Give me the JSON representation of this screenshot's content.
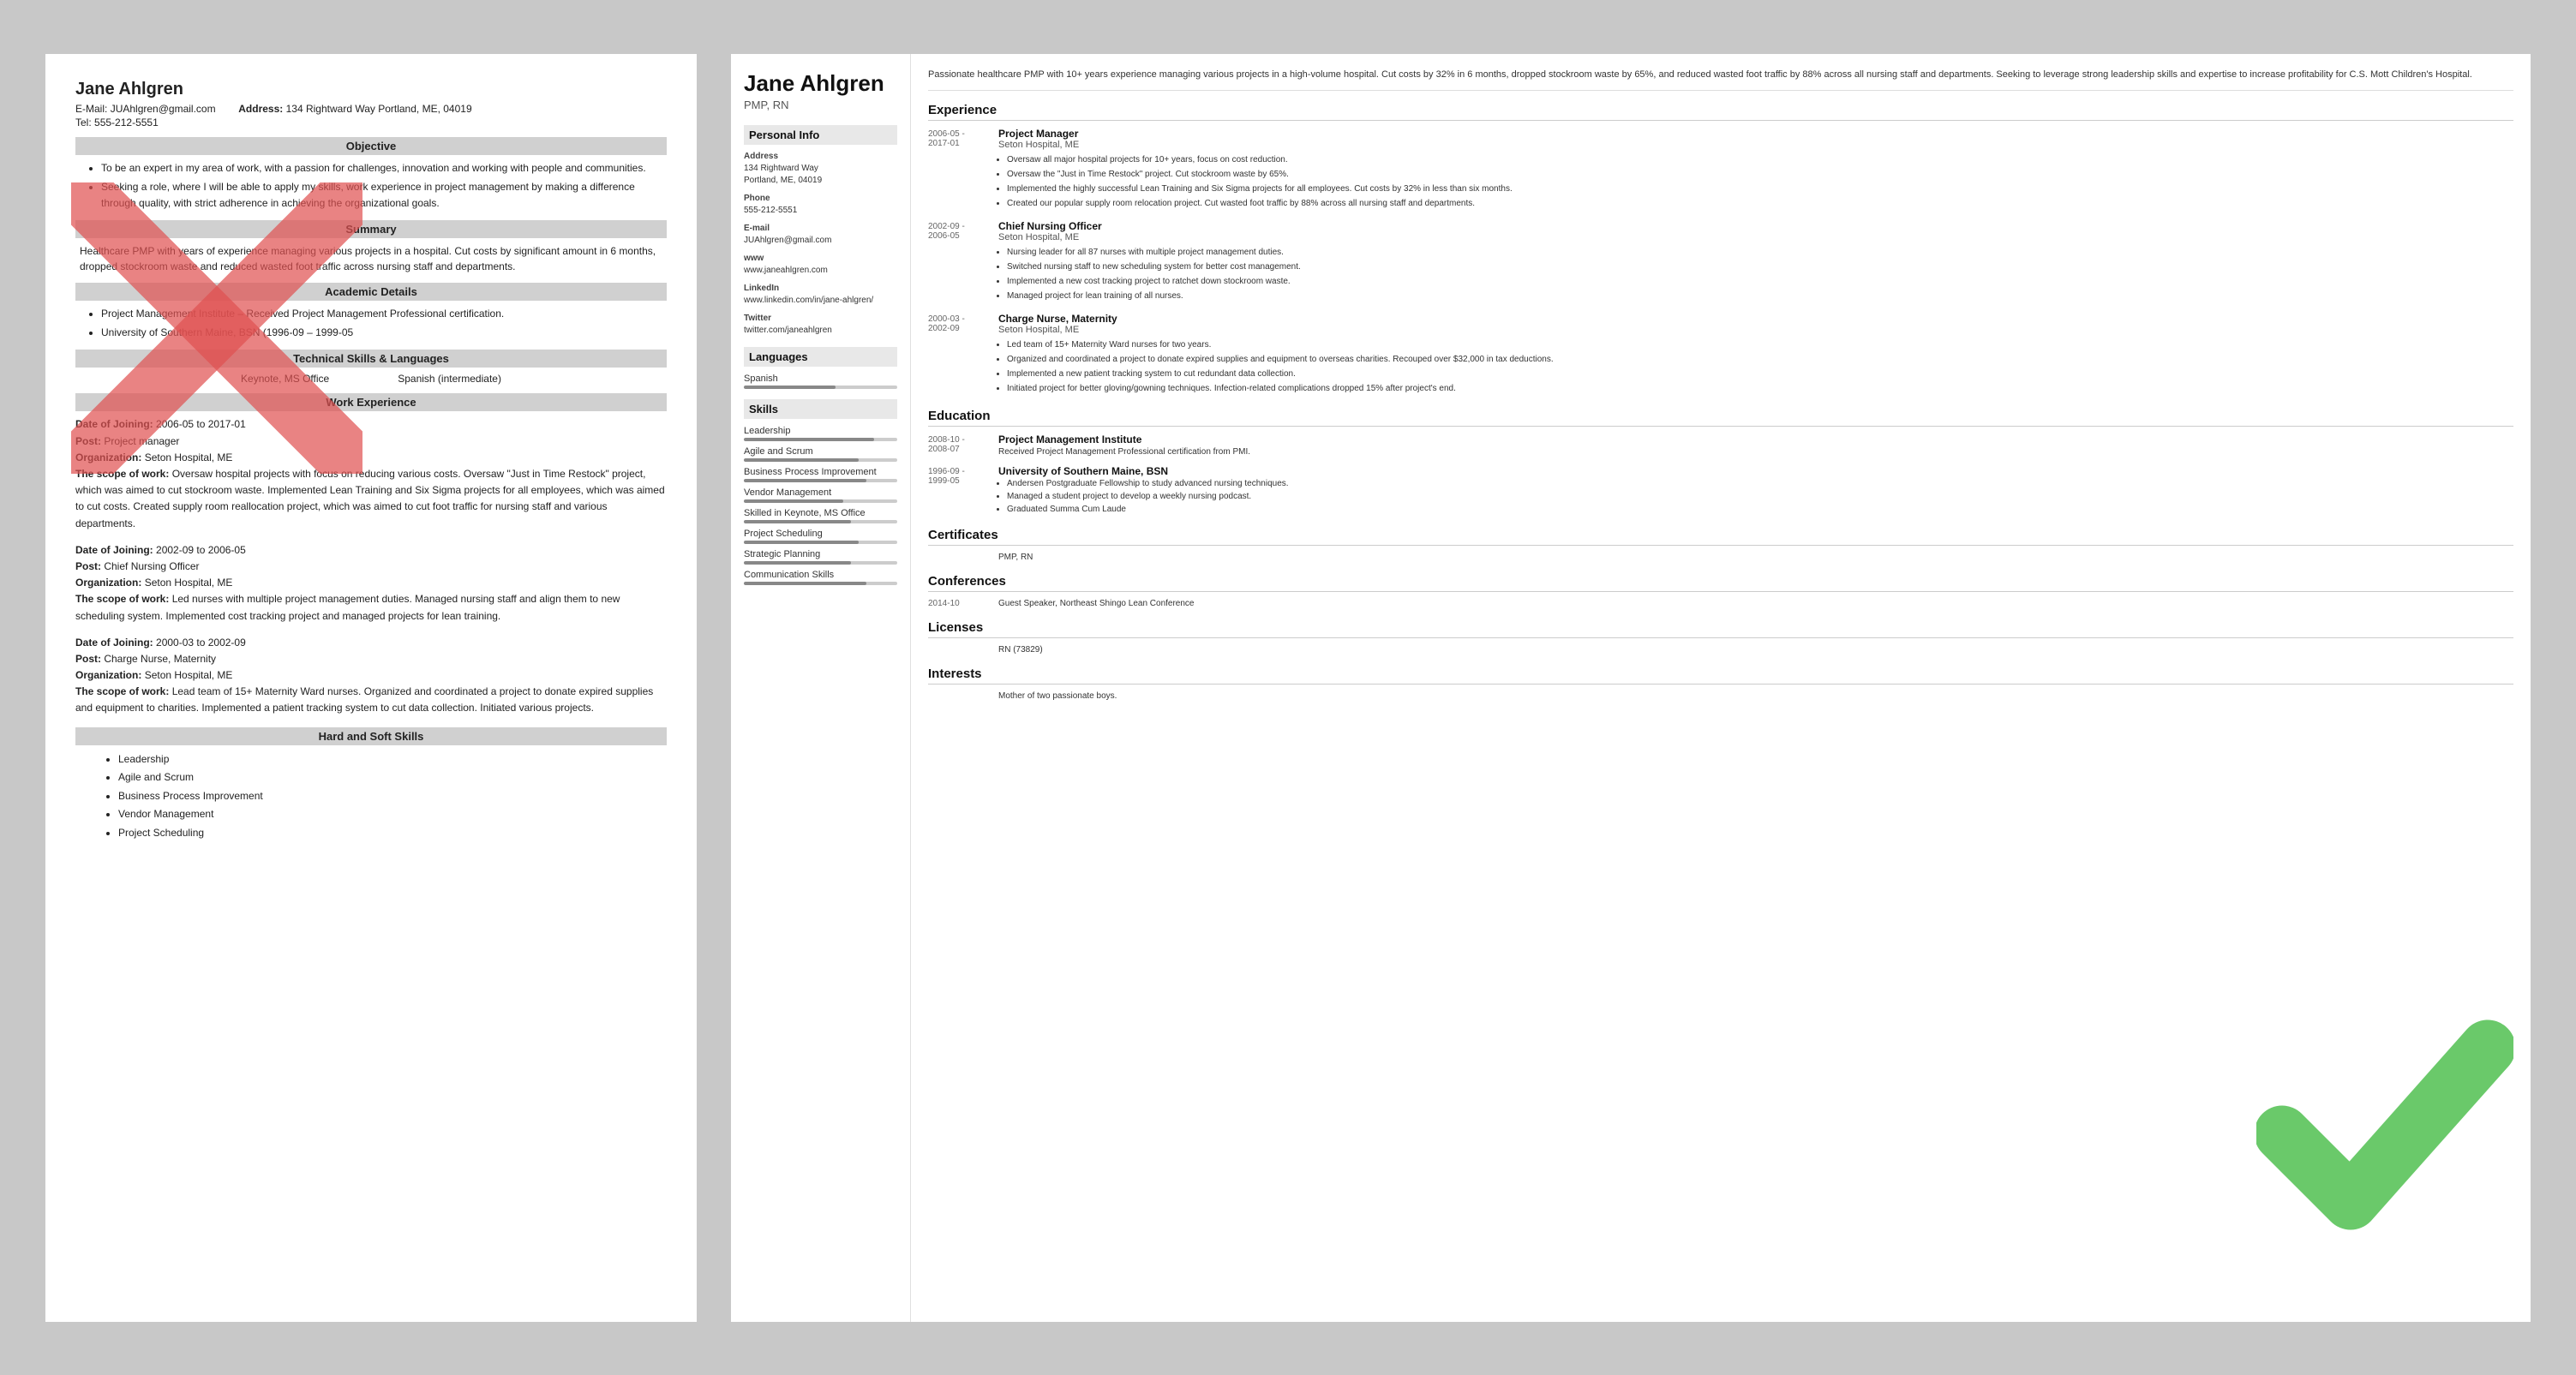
{
  "left": {
    "name": "Jane Ahlgren",
    "email_label": "E-Mail:",
    "email": "JUAhlgren@gmail.com",
    "address_label": "Address:",
    "address": "134 Rightward Way Portland, ME, 04019",
    "tel_label": "Tel:",
    "tel": "555-212-5551",
    "sections": {
      "objective": "Objective",
      "summary": "Summary",
      "academic": "Academic Details",
      "technical": "Technical Skills & Languages",
      "work": "Work Experience",
      "hard_soft": "Hard and Soft Skills"
    },
    "objective_bullets": [
      "To be an expert in my area of work, with a passion for challenges, innovation and working with people and communities.",
      "Seeking a role, where I will be able to apply my skills, work experience in project management by making a difference through quality, with strict adherence in achieving the organizational goals."
    ],
    "summary_text": "Healthcare PMP with years of experience managing various projects in a hospital. Cut costs by significant amount in 6 months, dropped stockroom waste and reduced wasted foot traffic across nursing staff and departments.",
    "academic_bullets": [
      "Project Management Institute – Received Project Management Professional certification.",
      "University of Southern Maine, BSN (1996-09 – 1999-05"
    ],
    "skill1": "Keynote, MS Office",
    "skill2": "Spanish (intermediate)",
    "work_entries": [
      {
        "date_label": "Date of Joining:",
        "date": "2006-05 to 2017-01",
        "post_label": "Post:",
        "post": "Project manager",
        "org_label": "Organization:",
        "org": "Seton Hospital, ME",
        "scope_label": "The scope of work:",
        "scope": "Oversaw hospital projects with focus on reducing various costs. Oversaw \"Just in Time Restock\" project, which was aimed to cut stockroom waste. Implemented Lean Training and Six Sigma projects for all employees, which was aimed to cut costs. Created supply room reallocation project, which was aimed to cut foot traffic for nursing staff and various departments."
      },
      {
        "date_label": "Date of Joining:",
        "date": "2002-09 to 2006-05",
        "post_label": "Post:",
        "post": "Chief Nursing Officer",
        "org_label": "Organization:",
        "org": "Seton Hospital, ME",
        "scope_label": "The scope of work:",
        "scope": "Led nurses with multiple project management duties. Managed nursing staff and align them to new scheduling system. Implemented cost tracking project and managed projects for lean training."
      },
      {
        "date_label": "Date of Joining:",
        "date": "2000-03 to 2002-09",
        "post_label": "Post:",
        "post": "Charge Nurse, Maternity",
        "org_label": "Organization:",
        "org": "Seton Hospital, ME",
        "scope_label": "The scope of work:",
        "scope": "Lead team of 15+ Maternity Ward nurses. Organized and coordinated a project to donate expired supplies and equipment to charities. Implemented a patient tracking system to cut data collection. Initiated various projects."
      }
    ],
    "hard_skills": [
      "Leadership",
      "Agile and Scrum",
      "Business Process Improvement",
      "Vendor Management",
      "Project Scheduling"
    ]
  },
  "right": {
    "name": "Jane Ahlgren",
    "title": "PMP, RN",
    "summary": "Passionate healthcare PMP with 10+ years experience managing various projects in a high-volume hospital. Cut costs by 32% in 6 months, dropped stockroom waste by 65%, and reduced wasted foot traffic by 88% across all nursing staff and departments. Seeking to leverage strong leadership skills and expertise to increase profitability for C.S. Mott Children's Hospital.",
    "personal_section": "Personal Info",
    "address_label": "Address",
    "address": "134 Rightward Way\nPortland, ME, 04019",
    "phone_label": "Phone",
    "phone": "555-212-5551",
    "email_label": "E-mail",
    "email": "JUAhlgren@gmail.com",
    "www_label": "www",
    "www": "www.janeahlgren.com",
    "linkedin_label": "LinkedIn",
    "linkedin": "www.linkedin.com/in/jane-ahlgren/",
    "twitter_label": "Twitter",
    "twitter": "twitter.com/janeahlgren",
    "languages_section": "Languages",
    "languages": [
      {
        "name": "Spanish",
        "level": 60
      }
    ],
    "skills_section": "Skills",
    "skills": [
      {
        "name": "Leadership",
        "level": 85
      },
      {
        "name": "Agile and Scrum",
        "level": 75
      },
      {
        "name": "Business Process Improvement",
        "level": 80
      },
      {
        "name": "Vendor Management",
        "level": 65
      },
      {
        "name": "Skilled in Keynote, MS Office",
        "level": 70
      },
      {
        "name": "Project Scheduling",
        "level": 75
      },
      {
        "name": "Strategic Planning",
        "level": 70
      },
      {
        "name": "Communication Skills",
        "level": 80
      }
    ],
    "experience_section": "Experience",
    "experiences": [
      {
        "date": "2006-05 -\n2017-01",
        "title": "Project Manager",
        "company": "Seton Hospital, ME",
        "bullets": [
          "Oversaw all major hospital projects for 10+ years, focus on cost reduction.",
          "Oversaw the \"Just in Time Restock\" project. Cut stockroom waste by 65%.",
          "Implemented the highly successful Lean Training and Six Sigma projects for all employees. Cut costs by 32% in less than six months.",
          "Created our popular supply room relocation project. Cut wasted foot traffic by 88% across all nursing staff and departments."
        ]
      },
      {
        "date": "2002-09 -\n2006-05",
        "title": "Chief Nursing Officer",
        "company": "Seton Hospital, ME",
        "bullets": [
          "Nursing leader for all 87 nurses with multiple project management duties.",
          "Switched nursing staff to new scheduling system for better cost management.",
          "Implemented a new cost tracking project to ratchet down stockroom waste.",
          "Managed project for lean training of all nurses."
        ]
      },
      {
        "date": "2000-03 -\n2002-09",
        "title": "Charge Nurse, Maternity",
        "company": "Seton Hospital, ME",
        "bullets": [
          "Led team of 15+ Maternity Ward nurses for two years.",
          "Organized and coordinated a project to donate expired supplies and equipment to overseas charities. Recouped over $32,000 in tax deductions.",
          "Implemented a new patient tracking system to cut redundant data collection.",
          "Initiated project for better gloving/gowning techniques. Infection-related complications dropped 15% after project's end."
        ]
      }
    ],
    "education_section": "Education",
    "education": [
      {
        "date": "2008-10 -\n2008-07",
        "school": "Project Management Institute",
        "detail": "Received Project Management Professional certification from PMI.",
        "bullets": []
      },
      {
        "date": "1996-09 -\n1999-05",
        "school": "University of Southern Maine, BSN",
        "detail": "",
        "bullets": [
          "Andersen Postgraduate Fellowship to study advanced nursing techniques.",
          "Managed a student project to develop a weekly nursing podcast.",
          "Graduated Summa Cum Laude"
        ]
      }
    ],
    "certificates_section": "Certificates",
    "certificates": [
      {
        "date": "",
        "value": "PMP, RN"
      }
    ],
    "conferences_section": "Conferences",
    "conferences": [
      {
        "date": "2014-10",
        "value": "Guest Speaker, Northeast Shingo Lean Conference"
      }
    ],
    "licenses_section": "Licenses",
    "licenses": [
      {
        "date": "",
        "value": "RN (73829)"
      }
    ],
    "interests_section": "Interests",
    "interests": [
      {
        "date": "",
        "value": "Mother of two passionate boys."
      }
    ]
  }
}
